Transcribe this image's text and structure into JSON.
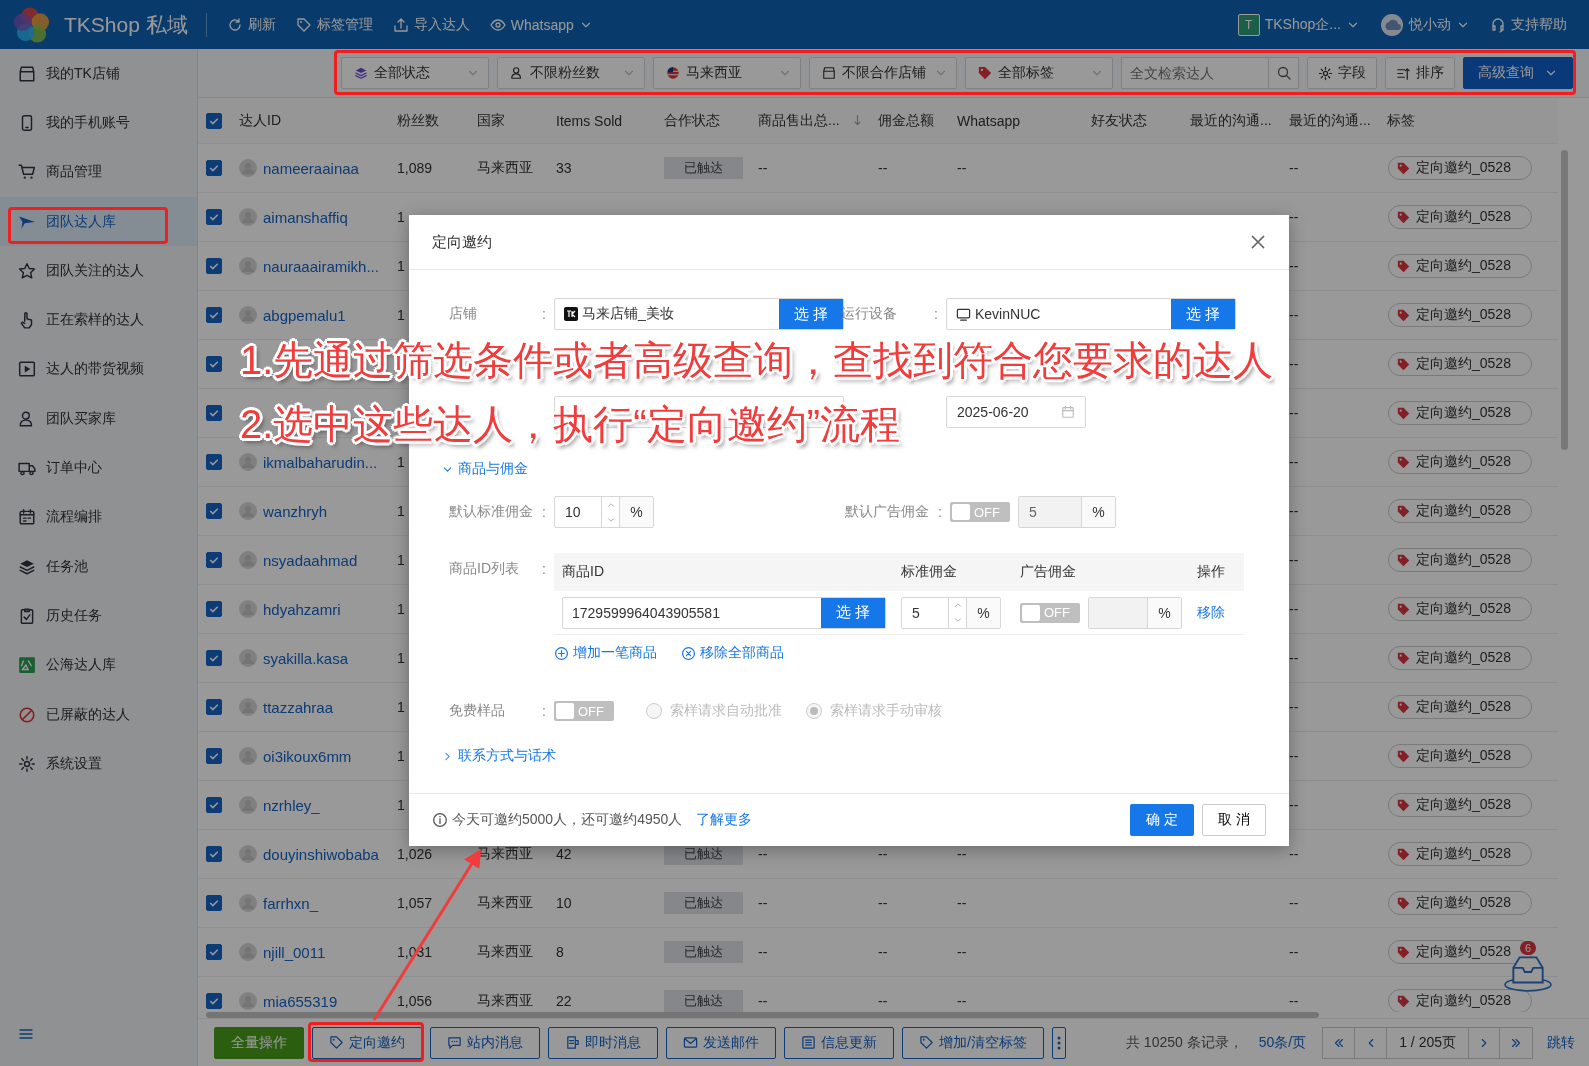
{
  "header": {
    "brand": "TKShop 私域",
    "actions": [
      {
        "label": "刷新",
        "dropdown": false
      },
      {
        "label": "标签管理",
        "dropdown": false
      },
      {
        "label": "导入达人",
        "dropdown": false
      },
      {
        "label": "Whatsapp",
        "dropdown": true
      }
    ],
    "enterprise": {
      "badge": "T",
      "name": "TKShop企..."
    },
    "user": {
      "name": "悦小动"
    },
    "help": "支持帮助"
  },
  "filters": {
    "dropdowns": [
      "全部状态",
      "不限粉丝数",
      "马来西亚",
      "不限合作店铺",
      "全部标签"
    ],
    "search": {
      "placeholder": "全文检索达人"
    },
    "buttons": [
      {
        "label": "字段",
        "kind": "default"
      },
      {
        "label": "排序",
        "kind": "default"
      },
      {
        "label": "高级查询",
        "kind": "primary"
      }
    ]
  },
  "sidebar": {
    "items": [
      {
        "label": "我的TK店铺",
        "selected": false
      },
      {
        "label": "我的手机账号",
        "selected": false
      },
      {
        "label": "商品管理",
        "selected": false
      },
      {
        "label": "团队达人库",
        "selected": true
      },
      {
        "label": "团队关注的达人",
        "selected": false
      },
      {
        "label": "正在索样的达人",
        "selected": false
      },
      {
        "label": "达人的带货视频",
        "selected": false
      },
      {
        "label": "团队买家库",
        "selected": false
      },
      {
        "label": "订单中心",
        "selected": false
      },
      {
        "label": "流程编排",
        "selected": false
      },
      {
        "label": "任务池",
        "selected": false
      },
      {
        "label": "历史任务",
        "selected": false
      },
      {
        "label": "公海达人库",
        "selected": false
      },
      {
        "label": "已屏蔽的达人",
        "selected": false
      },
      {
        "label": "系统设置",
        "selected": false
      }
    ]
  },
  "table": {
    "all_checked": true,
    "columns": [
      {
        "label": "达人ID",
        "sorted": false
      },
      {
        "label": "粉丝数",
        "sorted": false
      },
      {
        "label": "国家",
        "sorted": false
      },
      {
        "label": "Items Sold",
        "sorted": false
      },
      {
        "label": "合作状态",
        "sorted": false
      },
      {
        "label": "商品售出总...",
        "sorted": true
      },
      {
        "label": "佣金总额",
        "sorted": false
      },
      {
        "label": "Whatsapp",
        "sorted": false
      },
      {
        "label": "好友状态",
        "sorted": false
      },
      {
        "label": "最近的沟通...",
        "sorted": false
      },
      {
        "label": "最近的沟通...",
        "sorted": false
      },
      {
        "label": "标签",
        "sorted": false
      }
    ],
    "rows": [
      {
        "checked": true,
        "id": "nameeraainaa",
        "fans": "1,089",
        "country": "马来西亚",
        "items": "33",
        "status": "已触达",
        "sales": "--",
        "commission": "--",
        "whatsapp": "--",
        "recent_2": "--",
        "tag": "定向邀约_0528"
      },
      {
        "checked": true,
        "id": "aimanshaffiq",
        "fans": "1",
        "recent_2": "--",
        "tag": "定向邀约_0528"
      },
      {
        "checked": true,
        "id": "nauraaairamikh...",
        "fans": "1",
        "recent_2": "--",
        "tag": "定向邀约_0528"
      },
      {
        "checked": true,
        "id": "abgpemalu1",
        "fans": "1",
        "recent_2": "--",
        "tag": "定向邀约_0528"
      },
      {
        "checked": true,
        "recent_2": "--",
        "tag": "定向邀约_0528"
      },
      {
        "checked": true,
        "recent_2": "--",
        "tag": "定向邀约_0528"
      },
      {
        "checked": true,
        "id": "ikmalbaharudin...",
        "fans": "1",
        "recent_2": "--",
        "tag": "定向邀约_0528"
      },
      {
        "checked": true,
        "id": "wanzhryh",
        "fans": "1",
        "recent_2": "--",
        "tag": "定向邀约_0528"
      },
      {
        "checked": true,
        "id": "nsyadaahmad",
        "fans": "1",
        "recent_2": "--",
        "tag": "定向邀约_0528"
      },
      {
        "checked": true,
        "id": "hdyahzamri",
        "fans": "1",
        "recent_2": "--",
        "tag": "定向邀约_0528"
      },
      {
        "checked": true,
        "id": "syakilla.kasa",
        "fans": "1",
        "recent_2": "--",
        "tag": "定向邀约_0528"
      },
      {
        "checked": true,
        "id": "ttazzahraa",
        "fans": "1",
        "recent_2": "--",
        "tag": "定向邀约_0528"
      },
      {
        "checked": true,
        "id": "oi3ikoux6mm",
        "fans": "1",
        "recent_2": "--",
        "tag": "定向邀约_0528"
      },
      {
        "checked": true,
        "id": "nzrhley_",
        "fans": "1",
        "recent_2": "--",
        "tag": "定向邀约_0528"
      },
      {
        "checked": true,
        "id": "douyinshiwobaba",
        "fans": "1,026",
        "country": "马来西亚",
        "items": "42",
        "status": "已触达",
        "sales": "--",
        "commission": "--",
        "whatsapp": "--",
        "recent_2": "--",
        "tag": "定向邀约_0528"
      },
      {
        "checked": true,
        "id": "farrhxn_",
        "fans": "1,057",
        "country": "马来西亚",
        "items": "10",
        "status": "已触达",
        "sales": "--",
        "commission": "--",
        "whatsapp": "--",
        "recent_2": "--",
        "tag": "定向邀约_0528"
      },
      {
        "checked": true,
        "id": "njill_0011",
        "fans": "1,031",
        "country": "马来西亚",
        "items": "8",
        "status": "已触达",
        "sales": "--",
        "commission": "--",
        "whatsapp": "--",
        "recent_2": "--",
        "tag": "定向邀约_0528"
      },
      {
        "checked": true,
        "id": "mia655319",
        "fans": "1,056",
        "country": "马来西亚",
        "items": "22",
        "status": "已触达",
        "sales": "--",
        "commission": "--",
        "whatsapp": "--",
        "recent_2": "--",
        "tag": "定向邀约_0528"
      }
    ]
  },
  "widget": {
    "badge": "6"
  },
  "bottom": {
    "buttons": [
      {
        "label": "全量操作",
        "kind": "primary"
      },
      {
        "label": "定向邀约",
        "kind": "default"
      },
      {
        "label": "站内消息",
        "kind": "default"
      },
      {
        "label": "即时消息",
        "kind": "default"
      },
      {
        "label": "发送邮件",
        "kind": "default"
      },
      {
        "label": "信息更新",
        "kind": "default"
      },
      {
        "label": "增加/清空标签",
        "kind": "default"
      },
      {
        "kind": "more"
      }
    ],
    "total": "共 10250 条记录，",
    "page_size": "50条/页",
    "page": "1 / 205页",
    "jump": "跳转"
  },
  "modal": {
    "title": "定向邀约",
    "shop": {
      "label": "店铺",
      "colon": ":",
      "value": "马来店铺_美妆",
      "button": "选 择"
    },
    "device": {
      "label": "运行设备",
      "colon": ":",
      "value": "KevinNUC",
      "button": "选 择"
    },
    "plan": {
      "date": "2025-06-20"
    },
    "goods_section": {
      "label": "商品与佣金",
      "expanded": true
    },
    "default_commission": {
      "label": "默认标准佣金",
      "colon": ":",
      "value": "10",
      "unit": "%"
    },
    "ad_commission": {
      "label": "默认广告佣金",
      "colon": ":",
      "on": false,
      "toggle_text": "OFF",
      "value": "5",
      "unit": "%"
    },
    "products": {
      "label": "商品ID列表",
      "colon": ":",
      "columns": [
        "商品ID",
        "标准佣金",
        "广告佣金",
        "操作"
      ],
      "rows": [
        {
          "id": "1729599964043905581",
          "button": "选 择",
          "commission": "5",
          "unit": "%",
          "ad_on": false,
          "toggle_text": "OFF",
          "ad_unit": "%",
          "action": "移除"
        }
      ],
      "add": "增加一笔商品",
      "remove_all": "移除全部商品"
    },
    "free_sample": {
      "label": "免费样品",
      "colon": ":",
      "on": false,
      "toggle_text": "OFF",
      "disabled": true,
      "options": [
        {
          "label": "索样请求自动批准",
          "selected": false
        },
        {
          "label": "索样请求手动审核",
          "selected": true
        }
      ]
    },
    "contact_section": {
      "label": "联系方式与话术",
      "expanded": false
    },
    "quota": "今天可邀约5000人，还可邀约4950人",
    "learn_more": "了解更多",
    "ok": "确 定",
    "cancel": "取 消"
  },
  "annotation": {
    "lines": [
      "1.先通过筛选条件或者高级查询，查找到符合您要求的达人",
      "2.选中这些达人，执行“定向邀约”流程"
    ]
  }
}
